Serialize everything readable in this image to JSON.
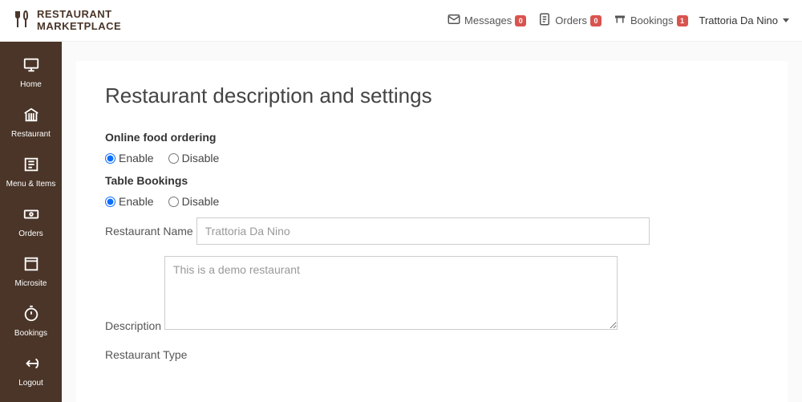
{
  "brand": {
    "line1": "RESTAURANT",
    "line2": "MARKETPLACE"
  },
  "top": {
    "messages": {
      "label": "Messages",
      "badge": "0"
    },
    "orders": {
      "label": "Orders",
      "badge": "0"
    },
    "bookings": {
      "label": "Bookings",
      "badge": "1"
    },
    "user": "Trattoria Da Nino"
  },
  "sidebar": {
    "items": [
      {
        "label": "Home"
      },
      {
        "label": "Restaurant"
      },
      {
        "label": "Menu & Items"
      },
      {
        "label": "Orders"
      },
      {
        "label": "Microsite"
      },
      {
        "label": "Bookings"
      },
      {
        "label": "Logout"
      }
    ]
  },
  "page": {
    "title": "Restaurant description and settings",
    "onlineOrdering": {
      "label": "Online food ordering",
      "enable": "Enable",
      "disable": "Disable"
    },
    "tableBookings": {
      "label": "Table Bookings",
      "enable": "Enable",
      "disable": "Disable"
    },
    "restaurantName": {
      "label": "Restaurant Name",
      "value": "Trattoria Da Nino"
    },
    "description": {
      "label": "Description",
      "value": "This is a demo restaurant"
    },
    "restaurantType": {
      "label": "Restaurant Type"
    }
  }
}
